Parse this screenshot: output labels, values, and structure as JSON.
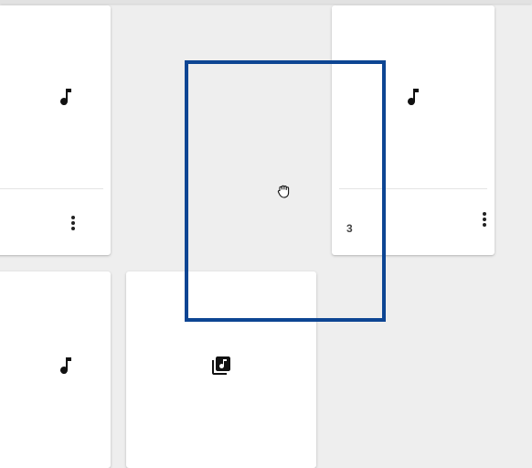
{
  "cards": [
    {
      "id": "card-top-left",
      "icon": "music-note-icon",
      "count": ""
    },
    {
      "id": "card-top-right",
      "icon": "music-note-icon",
      "count": "3"
    },
    {
      "id": "card-bottom-left",
      "icon": "music-note-icon",
      "count": ""
    },
    {
      "id": "card-bottom-middle",
      "icon": "album-icon",
      "count": ""
    }
  ],
  "menu_icon": "more-vert-icon",
  "cursor_icon": "grab-hand-icon",
  "colors": {
    "background": "#eeeeee",
    "card": "#ffffff",
    "selection_border": "#0d4593"
  }
}
